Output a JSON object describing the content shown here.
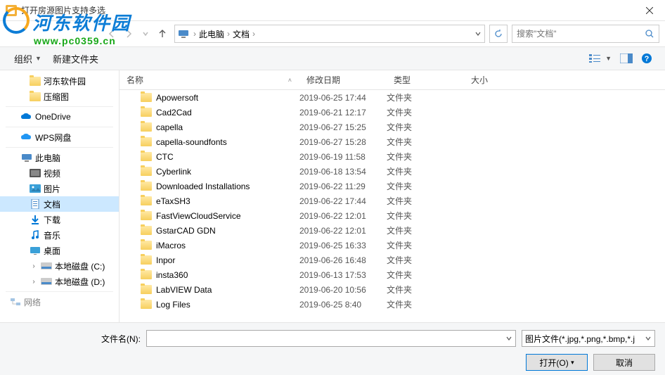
{
  "window": {
    "title": "打开房源图片支持多选"
  },
  "watermark": {
    "title": "河东软件园",
    "url": "www.pc0359.cn"
  },
  "breadcrumb": {
    "pc_icon_title": "此电脑",
    "items": [
      "此电脑",
      "文档"
    ]
  },
  "search": {
    "placeholder": "搜索\"文档\""
  },
  "toolbar": {
    "organize": "组织",
    "new_folder": "新建文件夹"
  },
  "columns": {
    "name": "名称",
    "date": "修改日期",
    "type": "类型",
    "size": "大小"
  },
  "sidebar": {
    "hedong": "河东软件园",
    "compressed": "压缩图",
    "onedrive": "OneDrive",
    "wps": "WPS网盘",
    "thispc": "此电脑",
    "videos": "视频",
    "pictures": "图片",
    "documents": "文档",
    "downloads": "下载",
    "music": "音乐",
    "desktop": "桌面",
    "disk_c": "本地磁盘 (C:)",
    "disk_d": "本地磁盘 (D:)",
    "network": "网络"
  },
  "files": [
    {
      "name": "Apowersoft",
      "date": "2019-06-25 17:44",
      "type": "文件夹",
      "size": ""
    },
    {
      "name": "Cad2Cad",
      "date": "2019-06-21 12:17",
      "type": "文件夹",
      "size": ""
    },
    {
      "name": "capella",
      "date": "2019-06-27 15:25",
      "type": "文件夹",
      "size": ""
    },
    {
      "name": "capella-soundfonts",
      "date": "2019-06-27 15:28",
      "type": "文件夹",
      "size": ""
    },
    {
      "name": "CTC",
      "date": "2019-06-19 11:58",
      "type": "文件夹",
      "size": ""
    },
    {
      "name": "Cyberlink",
      "date": "2019-06-18 13:54",
      "type": "文件夹",
      "size": ""
    },
    {
      "name": "Downloaded Installations",
      "date": "2019-06-22 11:29",
      "type": "文件夹",
      "size": ""
    },
    {
      "name": "eTaxSH3",
      "date": "2019-06-22 17:44",
      "type": "文件夹",
      "size": ""
    },
    {
      "name": "FastViewCloudService",
      "date": "2019-06-22 12:01",
      "type": "文件夹",
      "size": ""
    },
    {
      "name": "GstarCAD GDN",
      "date": "2019-06-22 12:01",
      "type": "文件夹",
      "size": ""
    },
    {
      "name": "iMacros",
      "date": "2019-06-25 16:33",
      "type": "文件夹",
      "size": ""
    },
    {
      "name": "Inpor",
      "date": "2019-06-26 16:48",
      "type": "文件夹",
      "size": ""
    },
    {
      "name": "insta360",
      "date": "2019-06-13 17:53",
      "type": "文件夹",
      "size": ""
    },
    {
      "name": "LabVIEW Data",
      "date": "2019-06-20 10:56",
      "type": "文件夹",
      "size": ""
    },
    {
      "name": "Log Files",
      "date": "2019-06-25 8:40",
      "type": "文件夹",
      "size": ""
    }
  ],
  "footer": {
    "filename_label": "文件名(N):",
    "filter": "图片文件(*.jpg,*.png,*.bmp,*.j",
    "open": "打开(O)",
    "cancel": "取消"
  }
}
